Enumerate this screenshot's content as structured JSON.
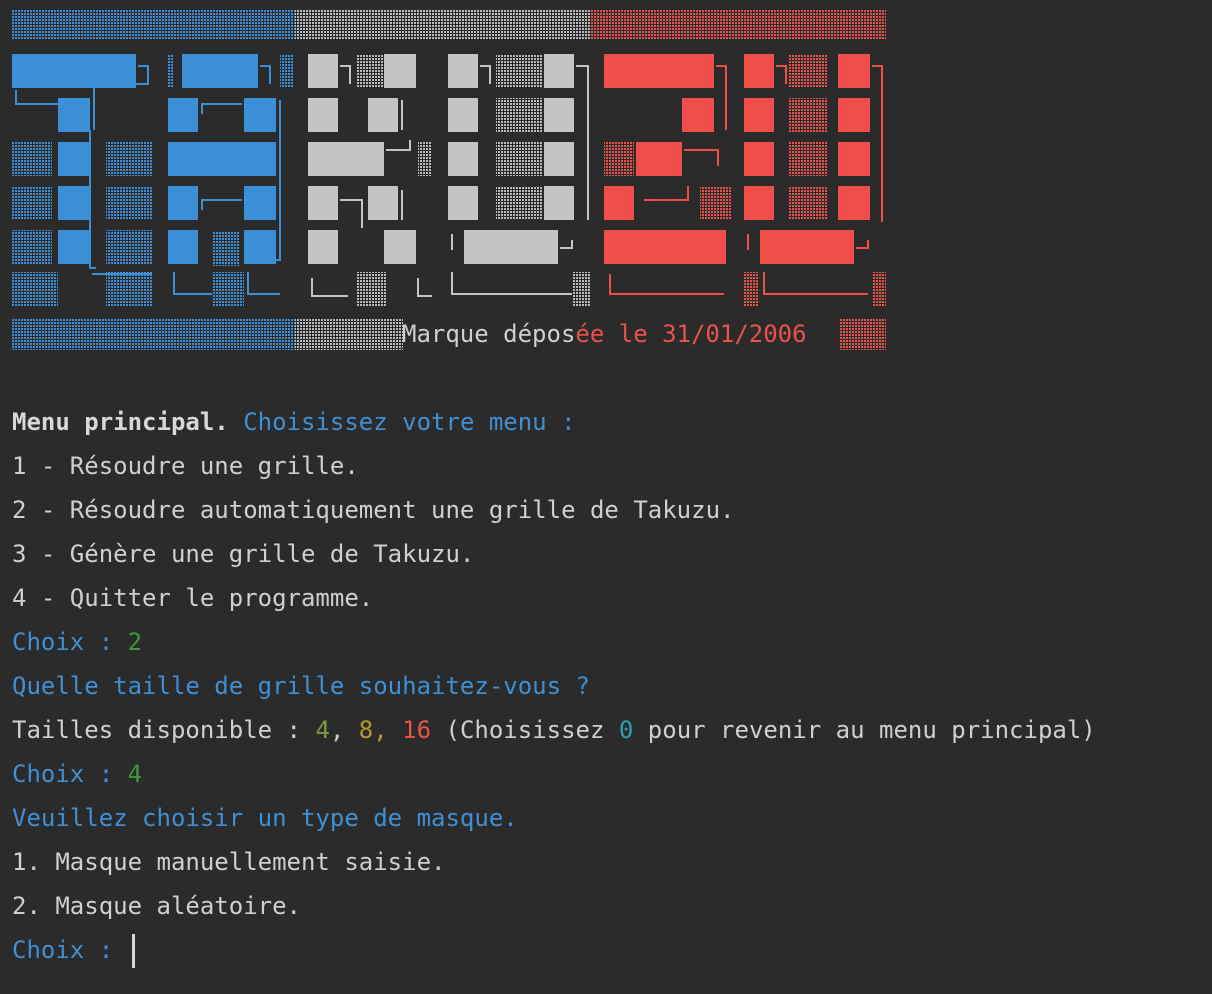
{
  "banner": {
    "colors": {
      "blue": "#3a8fd6",
      "gray": "#c4c4c4",
      "red": "#ef4f48"
    },
    "trademark_prefix": "Marque dépos",
    "trademark_suffix": "ée le 31/01/2006"
  },
  "menu": {
    "title": "Menu principal.",
    "prompt": " Choisissez votre menu :",
    "items": [
      "1 - Résoudre une grille.",
      "2 - Résoudre automatiquement une grille de Takuzu.",
      "3 - Génère une grille de Takuzu.",
      "4 - Quitter le programme."
    ]
  },
  "choice_label": "Choix : ",
  "choice1_value": "2",
  "size_question": "Quelle taille de grille souhaitez-vous ?",
  "sizes": {
    "label": "Tailles disponible : ",
    "s4": "4",
    "sep1": ", ",
    "s8": "8",
    "sep2": ", ",
    "s16": "16",
    "mid": " (Choisissez ",
    "zero": "0",
    "end": " pour revenir au menu principal)"
  },
  "choice2_value": "4",
  "mask_question": "Veuillez choisir un type de masque.",
  "mask_options": [
    "1. Masque manuellement saisie.",
    "2. Masque aléatoire."
  ]
}
